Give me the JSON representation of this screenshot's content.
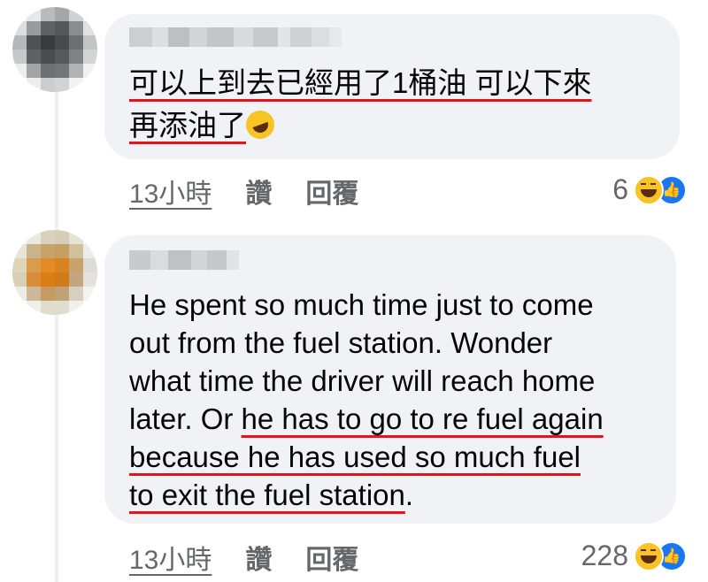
{
  "comments": [
    {
      "text_lines": [
        [
          "可以上到去已經用了1桶油 可以下來"
        ],
        [
          "再添油了"
        ]
      ],
      "emoji": "rolling-on-floor-laughing-emoji",
      "time": "13小時",
      "like_label": "讚",
      "reply_label": "回覆",
      "reaction_count": "6"
    },
    {
      "line1": "He spent so much time just to come",
      "line2": "out from the fuel station. Wonder",
      "line3": "what time the driver will reach home",
      "line4_plain": "later. Or ",
      "line4_underlined": "he has to go to re fuel again",
      "line5": "because he has used so much fuel",
      "line6_underlined": "to exit the fuel station",
      "line6_end": ".",
      "time": "13小時",
      "like_label": "讚",
      "reply_label": "回覆",
      "reaction_count": "228"
    }
  ],
  "colors": {
    "bubble": "#f0f2f5",
    "underline": "#e3141b",
    "meta": "#65676b",
    "like_blue": "#1877f2",
    "haha_yellow": "#f7c325"
  }
}
